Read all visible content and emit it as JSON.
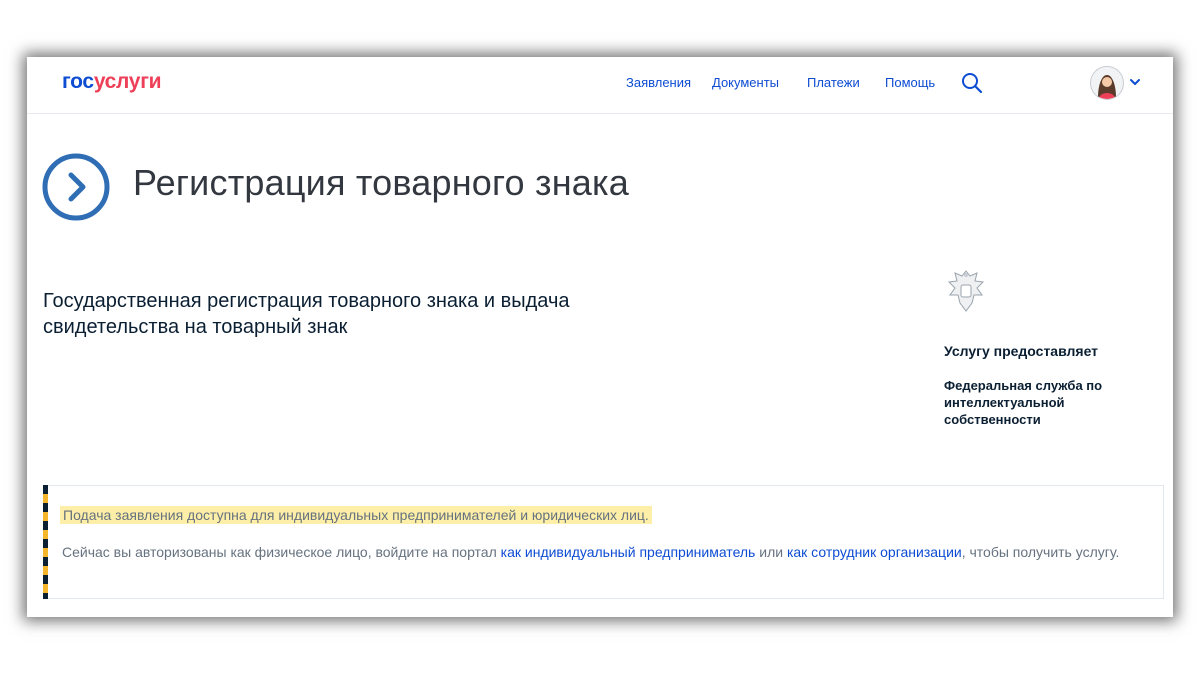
{
  "header": {
    "logo_part1": "гос",
    "logo_part2": "услуги",
    "nav": [
      "Заявления",
      "Документы",
      "Платежи",
      "Помощь"
    ]
  },
  "page": {
    "title": "Регистрация товарного знака",
    "service_name": "Государственная регистрация товарного знака и выдача свидетельства на товарный знак"
  },
  "provider": {
    "label": "Услугу предоставляет",
    "name": "Федеральная служба по интеллектуальной собственности"
  },
  "notice": {
    "title": "Подача заявления доступна для индивидуальных предпринимателей и юридических лиц.",
    "text_before": "Сейчас вы авторизованы как физическое лицо, войдите на портал ",
    "link_entrepreneur": "как индивидуальный предприниматель",
    "text_or": " или ",
    "link_employee": "как сотрудник организации",
    "text_after": ", чтобы получить услугу."
  },
  "colors": {
    "brand_blue": "#0d4cd3",
    "brand_red": "#ee3f58",
    "title_icon_blue": "#2f6db4",
    "highlight_yellow": "#fdeea8",
    "stripe_yellow": "#f5b62b"
  },
  "icons": [
    "search-icon",
    "avatar",
    "chevron-down-icon",
    "arrow-circle-icon",
    "coat-of-arms-icon"
  ]
}
